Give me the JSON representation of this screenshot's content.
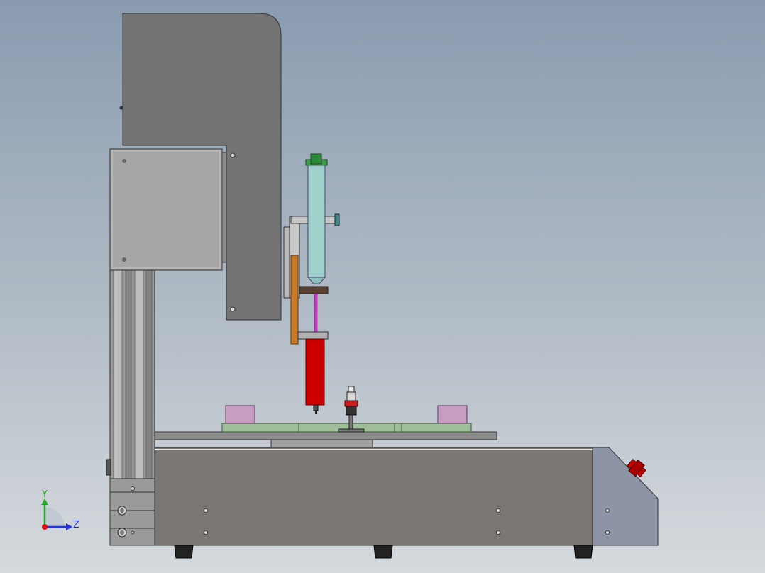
{
  "triad": {
    "y_label": "Y",
    "z_label": "Z",
    "colors": {
      "y": "#1faa1f",
      "z": "#2233dd",
      "x": "#dd1111"
    }
  },
  "colors": {
    "frame": "#7a7672",
    "column": "#737373",
    "head_box": "#a6a6a6",
    "syringe": "#9fd0cc",
    "syringe_cap": "#2a8a3a",
    "valve_body": "#cc0000",
    "needle": "#cc33cc",
    "bracket": "#c87a2a",
    "fixture": "#9fbf9a",
    "pad": "#c99cc4",
    "end_panel": "#8d94a6",
    "foot": "#222222",
    "e_stop": "#cc0000"
  }
}
